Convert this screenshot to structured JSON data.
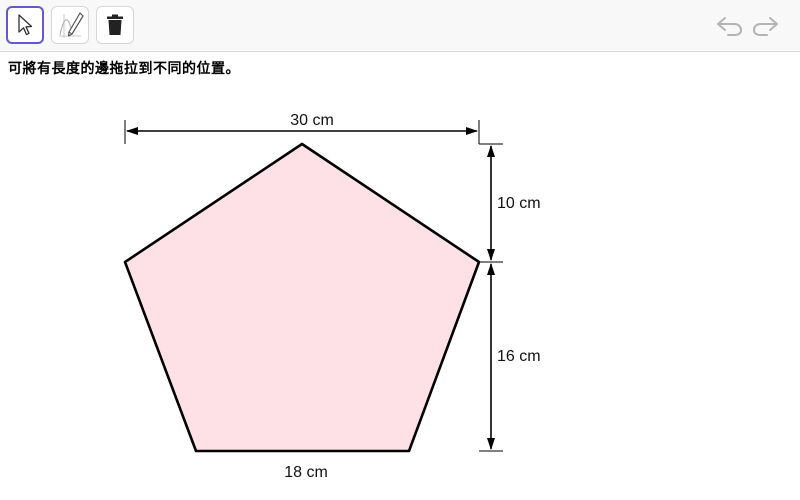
{
  "toolbar": {
    "tools": [
      {
        "name": "move-tool",
        "icon": "arrow-cursor-icon",
        "active": true
      },
      {
        "name": "pen-tool",
        "icon": "pen-graph-icon",
        "active": false
      },
      {
        "name": "delete-tool",
        "icon": "trash-icon",
        "active": false
      }
    ],
    "undo_icon": "undo-icon",
    "redo_icon": "redo-icon"
  },
  "instruction": "可將有長度的邊拖拉到不同的位置。",
  "figure": {
    "shape": "pentagon",
    "fill_color": "#fde1e6",
    "stroke_color": "#000000",
    "labels": {
      "top_width": "30 cm",
      "upper_height": "10 cm",
      "lower_height": "16 cm",
      "bottom_side": "18 cm"
    }
  },
  "colors": {
    "active_tool_border": "#6557d2",
    "toolbar_bg": "#f8f8f9",
    "history_icon": "#b3b3b3"
  }
}
